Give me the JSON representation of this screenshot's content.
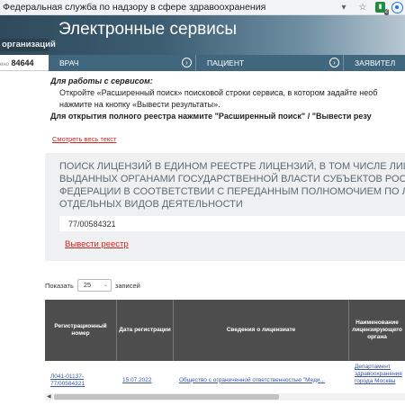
{
  "browser": {
    "title": "Федеральная служба по надзору в сфере здравоохранения",
    "ext_badge": "2",
    "icons": [
      "dropdown-arrow-icon",
      "star-icon",
      "extension-icon",
      "eye-icon"
    ]
  },
  "header": {
    "left_tab": "организаций",
    "title": "Электронные сервисы",
    "left_counter_label": "ено",
    "left_counter_value": "84644"
  },
  "nav": {
    "items": [
      {
        "label": "ВРАЧ"
      },
      {
        "label": "ПАЦИЕНТ"
      },
      {
        "label": "ЗАЯВИТЕЛ"
      }
    ]
  },
  "instructions": {
    "line1": "Для работы с сервисом:",
    "line2": "Откройте «Расширенный поиск» поисковой строки сервиса, в котором задайте необ",
    "line3": "нажмите на кнопку «Вывести результаты».",
    "line4": "Для открытия полного реестра нажмите \"Расширенный поиск\" / \"Вывести резу",
    "show_all": "Смотреть весь текст"
  },
  "search": {
    "heading_lines": [
      "ПОИСК ЛИЦЕНЗИЙ В ЕДИНОМ РЕЕСТРЕ ЛИЦЕНЗИЙ, В ТОМ ЧИСЛЕ ЛИЦЕНЗ",
      "ВЫДАННЫХ ОРГАНАМИ ГОСУДАРСТВЕННОЙ ВЛАСТИ СУБЪЕКТОВ РОССИЙС",
      "ФЕДЕРАЦИИ В СООТВЕТСТВИИ С ПЕРЕДАННЫМ ПОЛНОМОЧИЕМ ПО ЛИЦЕ",
      "ОТДЕЛЬНЫХ ВИДОВ ДЕЯТЕЛЬНОСТИ"
    ],
    "query": "77/00584321",
    "export_link": "Вывести реестр"
  },
  "entries": {
    "prefix": "Показать",
    "value": "25",
    "suffix": "записей"
  },
  "table": {
    "columns": [
      "Регистрационный номер",
      "Дата регистрации",
      "Сведения о лицензиате",
      "Наименование лицензирующего органа"
    ],
    "rows": [
      {
        "reg_number": "Л041-01137-77/00584321",
        "date": "15.07.2022",
        "licensee": "Общество с ограниченной ответственностью \"Меди...",
        "authority": "Департамент здравоохранения города Москвы"
      }
    ]
  }
}
